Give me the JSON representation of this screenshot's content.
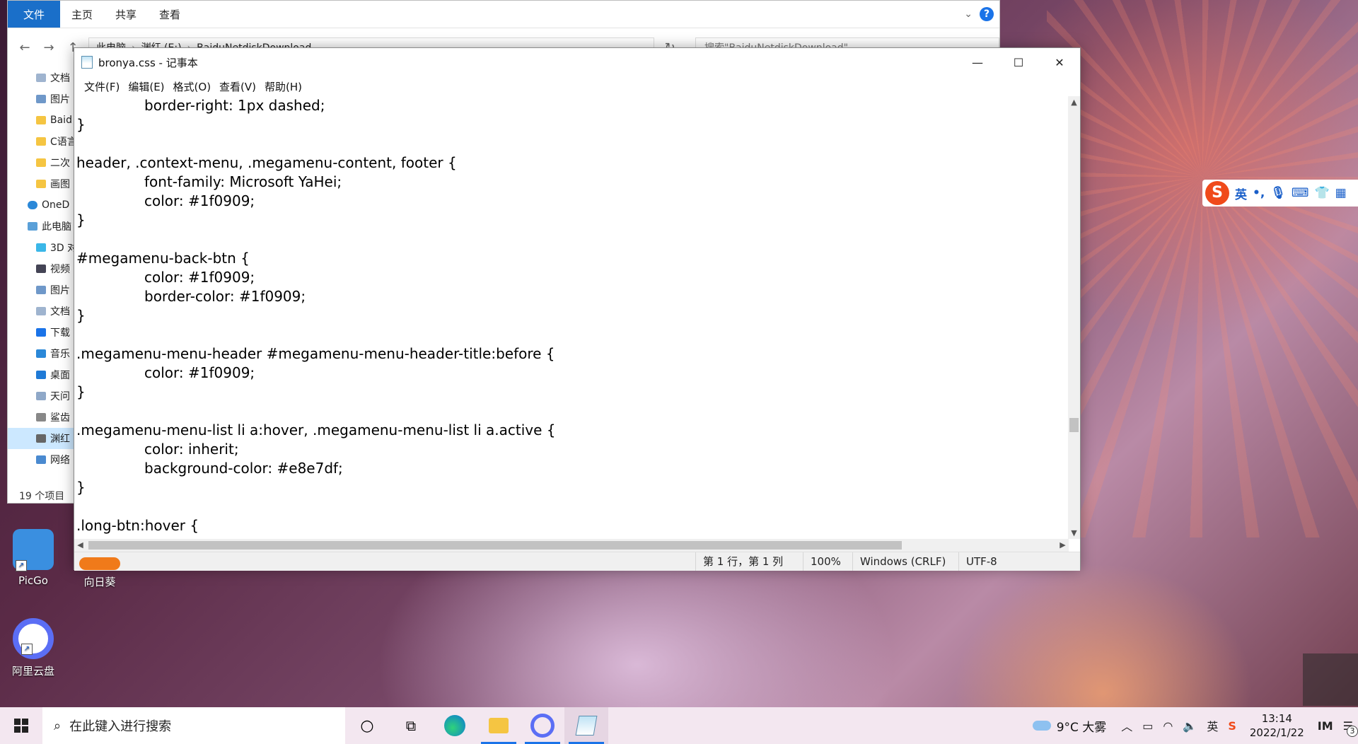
{
  "explorer": {
    "tabs": [
      "文件",
      "主页",
      "共享",
      "查看"
    ],
    "address_parts": [
      "此电脑",
      "渊红 (E:)",
      "BaiduNetdiskDownload"
    ],
    "search_placeholder": "搜索\"BaiduNetdiskDownload\"",
    "sidebar": [
      "文档",
      "图片",
      "Baid",
      "C语言",
      "二次",
      "画图",
      "OneD",
      "此电脑",
      "3D 对",
      "视频",
      "图片",
      "文档",
      "下载",
      "音乐",
      "桌面",
      "天问",
      "鲨齿",
      "渊红",
      "网络"
    ],
    "item_count": "19 个项目"
  },
  "notepad": {
    "title": "bronya.css - 记事本",
    "menu": [
      "文件(F)",
      "编辑(E)",
      "格式(O)",
      "查看(V)",
      "帮助(H)"
    ],
    "lines": [
      {
        "text": "border-right: 1px dashed;",
        "indent": true
      },
      {
        "text": "}",
        "indent": false
      },
      {
        "text": "",
        "indent": false
      },
      {
        "text": "header, .context-menu, .megamenu-content, footer {",
        "indent": false
      },
      {
        "text": "font-family: Microsoft YaHei;",
        "indent": true
      },
      {
        "text": "color: #1f0909;",
        "indent": true
      },
      {
        "text": "}",
        "indent": false
      },
      {
        "text": "",
        "indent": false
      },
      {
        "text": "#megamenu-back-btn {",
        "indent": false
      },
      {
        "text": "color: #1f0909;",
        "indent": true
      },
      {
        "text": "border-color: #1f0909;",
        "indent": true
      },
      {
        "text": "}",
        "indent": false
      },
      {
        "text": "",
        "indent": false
      },
      {
        "text": ".megamenu-menu-header #megamenu-menu-header-title:before {",
        "indent": false
      },
      {
        "text": "color: #1f0909;",
        "indent": true
      },
      {
        "text": "}",
        "indent": false
      },
      {
        "text": "",
        "indent": false
      },
      {
        "text": ".megamenu-menu-list li a:hover, .megamenu-menu-list li a.active {",
        "indent": false
      },
      {
        "text": "color: inherit;",
        "indent": true
      },
      {
        "text": "background-color: #e8e7df;",
        "indent": true
      },
      {
        "text": "}",
        "indent": false
      },
      {
        "text": "",
        "indent": false
      },
      {
        "text": ".long-btn:hover {",
        "indent": false
      }
    ],
    "status": {
      "position": "第 1 行，第 1 列",
      "zoom": "100%",
      "line_ending": "Windows (CRLF)",
      "encoding": "UTF-8"
    }
  },
  "ime": {
    "lang": "英"
  },
  "desktop_icons": [
    {
      "label": "PicGo"
    },
    {
      "label": "向日葵"
    },
    {
      "label": "阿里云盘"
    }
  ],
  "taskbar": {
    "search_placeholder": "在此键入进行搜索",
    "weather": "9°C  大雾",
    "time": "13:14",
    "date": "2022/1/22",
    "notification_count": "3"
  }
}
